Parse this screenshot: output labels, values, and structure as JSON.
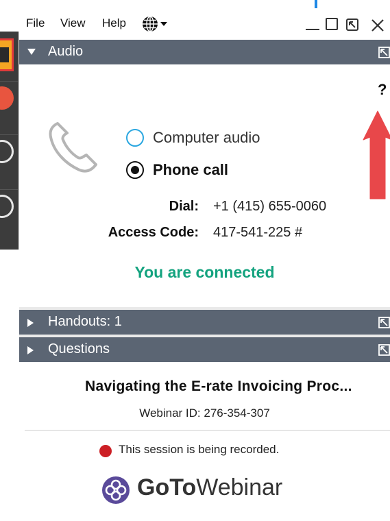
{
  "menu": {
    "file": "File",
    "view": "View",
    "help": "Help"
  },
  "sections": {
    "audio": "Audio",
    "handouts": "Handouts: 1",
    "questions": "Questions"
  },
  "audio": {
    "help_symbol": "?",
    "options": {
      "computer": "Computer audio",
      "phone": "Phone call"
    },
    "selected": "Phone call",
    "dial_label": "Dial:",
    "dial_value": "+1 (415) 655-0060",
    "access_label": "Access Code:",
    "access_value": "417-541-225 #",
    "status": "You are connected"
  },
  "webinar": {
    "title": "Navigating the E-rate Invoicing Proc...",
    "id_text": "Webinar ID: 276-354-307",
    "recording_text": "This session is being recorded."
  },
  "brand": {
    "logo_bold": "GoTo",
    "logo_light": "Webinar"
  },
  "colors": {
    "section_header": "#5b6573",
    "connected_green": "#14a37f",
    "recording_red": "#cc1f25",
    "radio_blue": "#2aa7e0",
    "arrow_red": "#e8474a"
  },
  "icons": {
    "globe": "globe-icon",
    "phone": "phone-icon",
    "popout": "popout-icon",
    "logo": "gotowebinar-logo-icon"
  }
}
